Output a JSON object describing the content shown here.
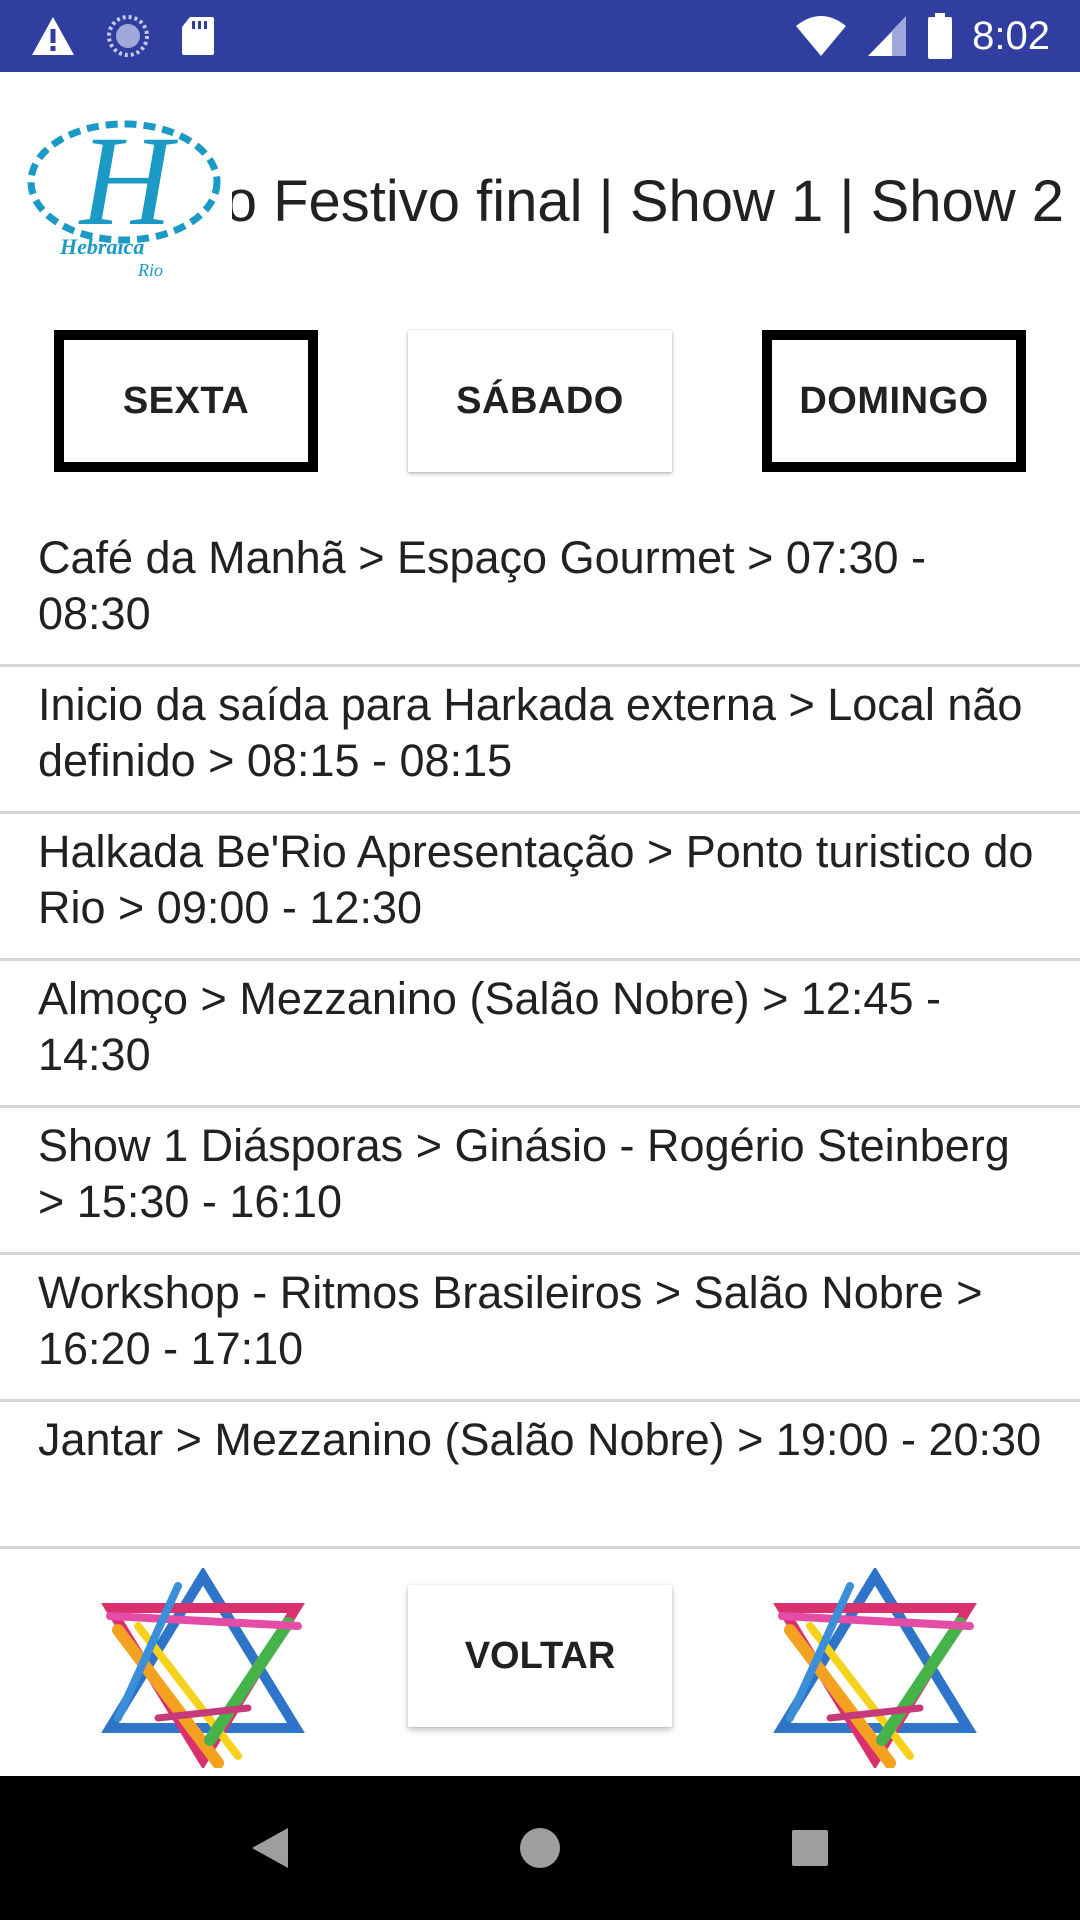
{
  "status_bar": {
    "time": "8:02",
    "icons": [
      "warning-icon",
      "sync-icon",
      "sd-card-icon",
      "wifi-icon",
      "signal-icon",
      "battery-icon"
    ],
    "background": "#303f9f"
  },
  "header": {
    "title": "Roteiro Festivo final | Show 1 | Show 2",
    "logo": {
      "name": "hebraica-rio-logo",
      "main_text": "Hebraica",
      "sub_text": "Rio",
      "color": "#1a9ac4"
    }
  },
  "day_tabs": {
    "sexta": "SEXTA",
    "sabado": "SÁBADO",
    "domingo": "DOMINGO"
  },
  "schedule": [
    "Café da Manhã > Espaço Gourmet > 07:30 - 08:30",
    "Inicio da saída para Harkada externa > Local não definido > 08:15 - 08:15",
    "Halkada Be'Rio Apresentação > Ponto turistico do Rio > 09:00 - 12:30",
    "Almoço > Mezzanino (Salão Nobre) > 12:45 - 14:30",
    "Show 1 Diásporas > Ginásio - Rogério Steinberg > 15:30 - 16:10",
    "Workshop - Ritmos Brasileiros > Salão Nobre > 16:20 - 17:10",
    "Jantar > Mezzanino (Salão Nobre) > 19:00 - 20:30"
  ],
  "footer": {
    "voltar_label": "VOLTAR",
    "star_icon": "star-of-david-icon"
  },
  "nav_bar": {
    "icons": [
      "back-icon",
      "home-icon",
      "recents-icon"
    ]
  }
}
